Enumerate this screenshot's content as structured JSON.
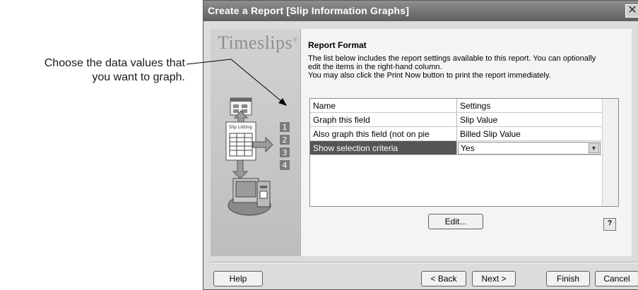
{
  "callout": {
    "line1": "Choose the data values that",
    "line2": "you want to graph."
  },
  "dialog": {
    "title": "Create a Report [Slip Information Graphs]",
    "close_glyph": "✕",
    "brand": "Timeslips",
    "brand_mark": "®",
    "side_art": {
      "list_label": "Slip Listing",
      "steps": [
        "1",
        "2",
        "3",
        "4"
      ]
    },
    "section_title": "Report Format",
    "description": [
      "The list below includes the report settings available to this report. You can optionally",
      "edit the items in the right-hand column.",
      "You may also click the Print Now button to print the report immediately."
    ],
    "grid": {
      "headers": {
        "name": "Name",
        "settings": "Settings"
      },
      "rows": [
        {
          "name": "Graph this field",
          "value": "Slip Value"
        },
        {
          "name": "Also graph this field (not on pie charts)",
          "value": "Billed Slip Value"
        },
        {
          "name": "Show selection criteria",
          "value": "Yes"
        }
      ],
      "dropdown_glyph": "▼"
    },
    "buttons": {
      "edit": "Edit...",
      "help": "Help",
      "back": "< Back",
      "next": "Next >",
      "finish": "Finish",
      "cancel": "Cancel"
    },
    "help_icon_glyph": "?"
  }
}
